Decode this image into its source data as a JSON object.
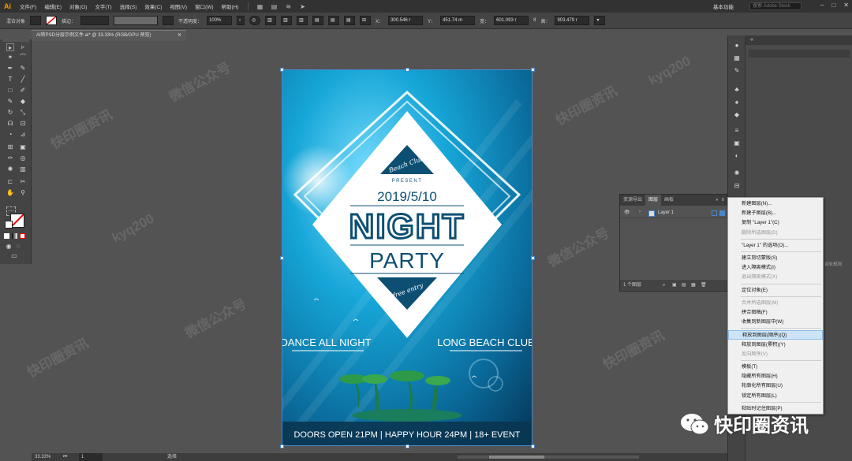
{
  "app": {
    "logo": "Ai",
    "workspace": "基本功能",
    "stock_placeholder": "搜索 Adobe Stock"
  },
  "menu": [
    "文件(F)",
    "编辑(E)",
    "对象(O)",
    "文字(T)",
    "选择(S)",
    "效果(C)",
    "视图(V)",
    "窗口(W)",
    "帮助(H)"
  ],
  "control": {
    "selection": "混合对象",
    "stroke_label": "描边：",
    "opacity_label": "不透明度：",
    "opacity": "100%",
    "x_label": "X：",
    "x": "300.546 r",
    "y_label": "Y：",
    "y": "451.74 m",
    "w_label": "宽：",
    "w": "601.093 r",
    "h_label": "高：",
    "h": "903.479 r"
  },
  "document": {
    "tab": "AI转PSD分层示例文件.ai* @ 33.33% (RGB/GPU 预览)"
  },
  "poster": {
    "present": "PRESENT",
    "badge_top": "Beach Club",
    "date": "2019/5/10",
    "title": "NIGHT",
    "subtitle": "PARTY",
    "badge_bottom": "free entry",
    "left_tag": "DANCE ALL NIGHT",
    "right_tag": "LONG BEACH CLUB",
    "footer": "DOORS OPEN 21PM  |  HAPPY HOUR 24PM  |  18+ EVENT"
  },
  "layers_panel": {
    "tabs": [
      "资源导出",
      "图层",
      "画板"
    ],
    "active_tab": "图层",
    "layer_name": "Layer 1",
    "footer": "1 个图层"
  },
  "context_menu": {
    "items": [
      {
        "label": "新建图层(N)...",
        "disabled": false
      },
      {
        "label": "新建子图层(B)...",
        "disabled": false
      },
      {
        "label": "复制 \"Layer 1\"(C)",
        "disabled": false
      },
      {
        "label": "删除所选图层(D)",
        "disabled": true
      },
      {
        "sep": true
      },
      {
        "label": "\"Layer 1\" 的选项(O)...",
        "disabled": false
      },
      {
        "sep": true
      },
      {
        "label": "建立剪切蒙版(S)",
        "disabled": false
      },
      {
        "label": "进入隔离模式(I)",
        "disabled": false
      },
      {
        "label": "退出隔离模式(X)",
        "disabled": true
      },
      {
        "sep": true
      },
      {
        "label": "定位对象(E)",
        "disabled": false
      },
      {
        "sep": true
      },
      {
        "label": "合并所选图层(M)",
        "disabled": true
      },
      {
        "label": "拼合图稿(F)",
        "disabled": false
      },
      {
        "label": "收集到新图层中(W)",
        "disabled": false
      },
      {
        "sep": true
      },
      {
        "label": "释放到图层(顺序)(Q)",
        "disabled": false,
        "highlight": true
      },
      {
        "label": "释放到图层(累积)(Y)",
        "disabled": false
      },
      {
        "label": "反向顺序(V)",
        "disabled": true
      },
      {
        "sep": true
      },
      {
        "label": "模板(T)",
        "disabled": false
      },
      {
        "label": "隐藏所有图层(H)",
        "disabled": false
      },
      {
        "label": "轮廓化所有图层(U)",
        "disabled": false
      },
      {
        "label": "锁定所有图层(L)",
        "disabled": false
      },
      {
        "sep": true
      },
      {
        "label": "粘贴时记住图层(P)",
        "disabled": false
      }
    ]
  },
  "right_hint": "对业规则",
  "status": {
    "zoom": "33.33%",
    "page": "1",
    "tool": "选择"
  },
  "watermarks": {
    "w1": "快印圈资讯",
    "w2": "微信公众号",
    "w3": "kyq200"
  },
  "brand": "快印圈资讯",
  "colors": {
    "accent": "#ff9a00",
    "highlight": "#cde4f7",
    "artboard": "#0a6f9e"
  }
}
